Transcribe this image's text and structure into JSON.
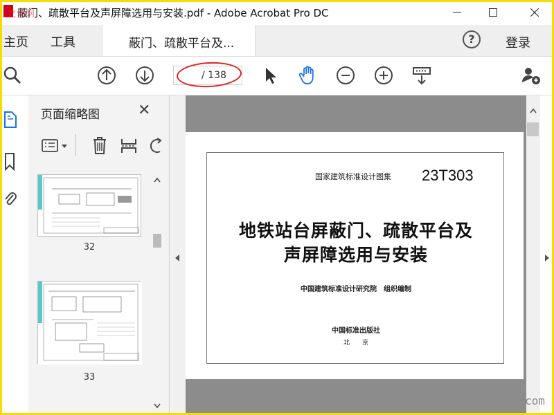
{
  "window": {
    "title": "蔽门、疏散平台及声屏障选用与安装.pdf - Adobe Acrobat Pro DC",
    "overlay_text": "之侠网"
  },
  "menu": {
    "home": "主页",
    "tools": "工具",
    "doc_tab": "蔽门、疏散平台及...",
    "login": "登录"
  },
  "toolbar": {
    "current_page": "",
    "total_pages": "/ 138"
  },
  "thumbnails": {
    "panel_title": "页面缩略图",
    "pages": [
      {
        "label": "32"
      },
      {
        "label": "33"
      }
    ]
  },
  "document": {
    "atlas": "国家建筑标准设计图集",
    "code": "23T303",
    "title_line1": "地铁站台屏蔽门、疏散平台及",
    "title_line2": "声屏障选用与安装",
    "editor": "中国建筑标准设计研究院　组织编制",
    "publisher": "中国标准出版社",
    "city": "北　　京"
  },
  "watermark": "com",
  "colors": {
    "annotation": "#e02020",
    "highlight_border": "#f5dd00",
    "accent_hand": "#1a73e8"
  }
}
